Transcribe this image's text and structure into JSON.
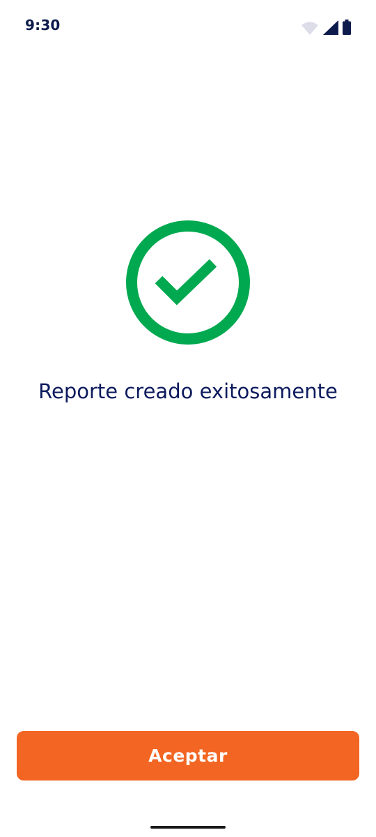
{
  "status_bar": {
    "time": "9:30",
    "icons": [
      "wifi-icon",
      "signal-icon",
      "battery-icon"
    ]
  },
  "main": {
    "icon": "check-circle-icon",
    "message": "Reporte creado exitosamente"
  },
  "actions": {
    "accept_label": "Aceptar"
  },
  "colors": {
    "accent": "#f26522",
    "success": "#00a94f",
    "text": "#0d1b5e"
  }
}
